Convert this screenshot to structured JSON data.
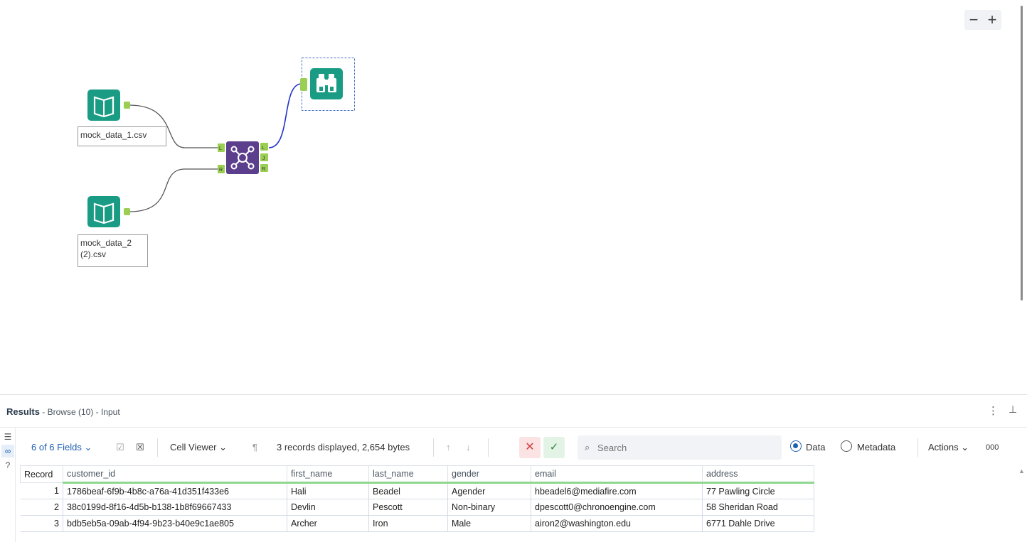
{
  "canvas": {
    "zoom_out": "−",
    "zoom_in": "+",
    "tools": [
      {
        "name": "input-tool-1",
        "icon": "book-icon",
        "label": "mock_data_1.csv"
      },
      {
        "name": "input-tool-2",
        "icon": "book-icon",
        "label_line1": "mock_data_2",
        "label_line2": "(2).csv"
      },
      {
        "name": "join-tool",
        "icon": "join-icon",
        "anchors_in": [
          "L",
          "R"
        ],
        "anchors_out": [
          "L",
          "J",
          "R"
        ]
      },
      {
        "name": "browse-tool",
        "icon": "binoculars-icon"
      }
    ],
    "colors": {
      "input": "#1a9c84",
      "join": "#5b3e8c",
      "anchor": "#9bcf53",
      "selected_link": "#2233cc",
      "link": "#555555"
    }
  },
  "results": {
    "title": "Results",
    "subtitle": " - Browse (10) - Input",
    "toolbar": {
      "fields": "6 of 6 Fields",
      "cell_viewer": "Cell Viewer",
      "summary": "3 records displayed, 2,654 bytes",
      "search_placeholder": "Search",
      "data_label": "Data",
      "metadata_label": "Metadata",
      "actions": "Actions",
      "more": "000"
    },
    "columns": [
      "Record",
      "customer_id",
      "first_name",
      "last_name",
      "gender",
      "email",
      "address"
    ],
    "rows": [
      [
        "1",
        "1786beaf-6f9b-4b8c-a76a-41d351f433e6",
        "Hali",
        "Beadel",
        "Agender",
        "hbeadel6@mediafire.com",
        "77 Pawling Circle"
      ],
      [
        "2",
        "38c0199d-8f16-4d5b-b138-1b8f69667433",
        "Devlin",
        "Pescott",
        "Non-binary",
        "dpescott0@chronoengine.com",
        "58 Sheridan Road"
      ],
      [
        "3",
        "bdb5eb5a-09ab-4f94-9b23-b40e9c1ae805",
        "Archer",
        "Iron",
        "Male",
        "airon2@washington.edu",
        "6771 Dahle Drive"
      ]
    ]
  }
}
